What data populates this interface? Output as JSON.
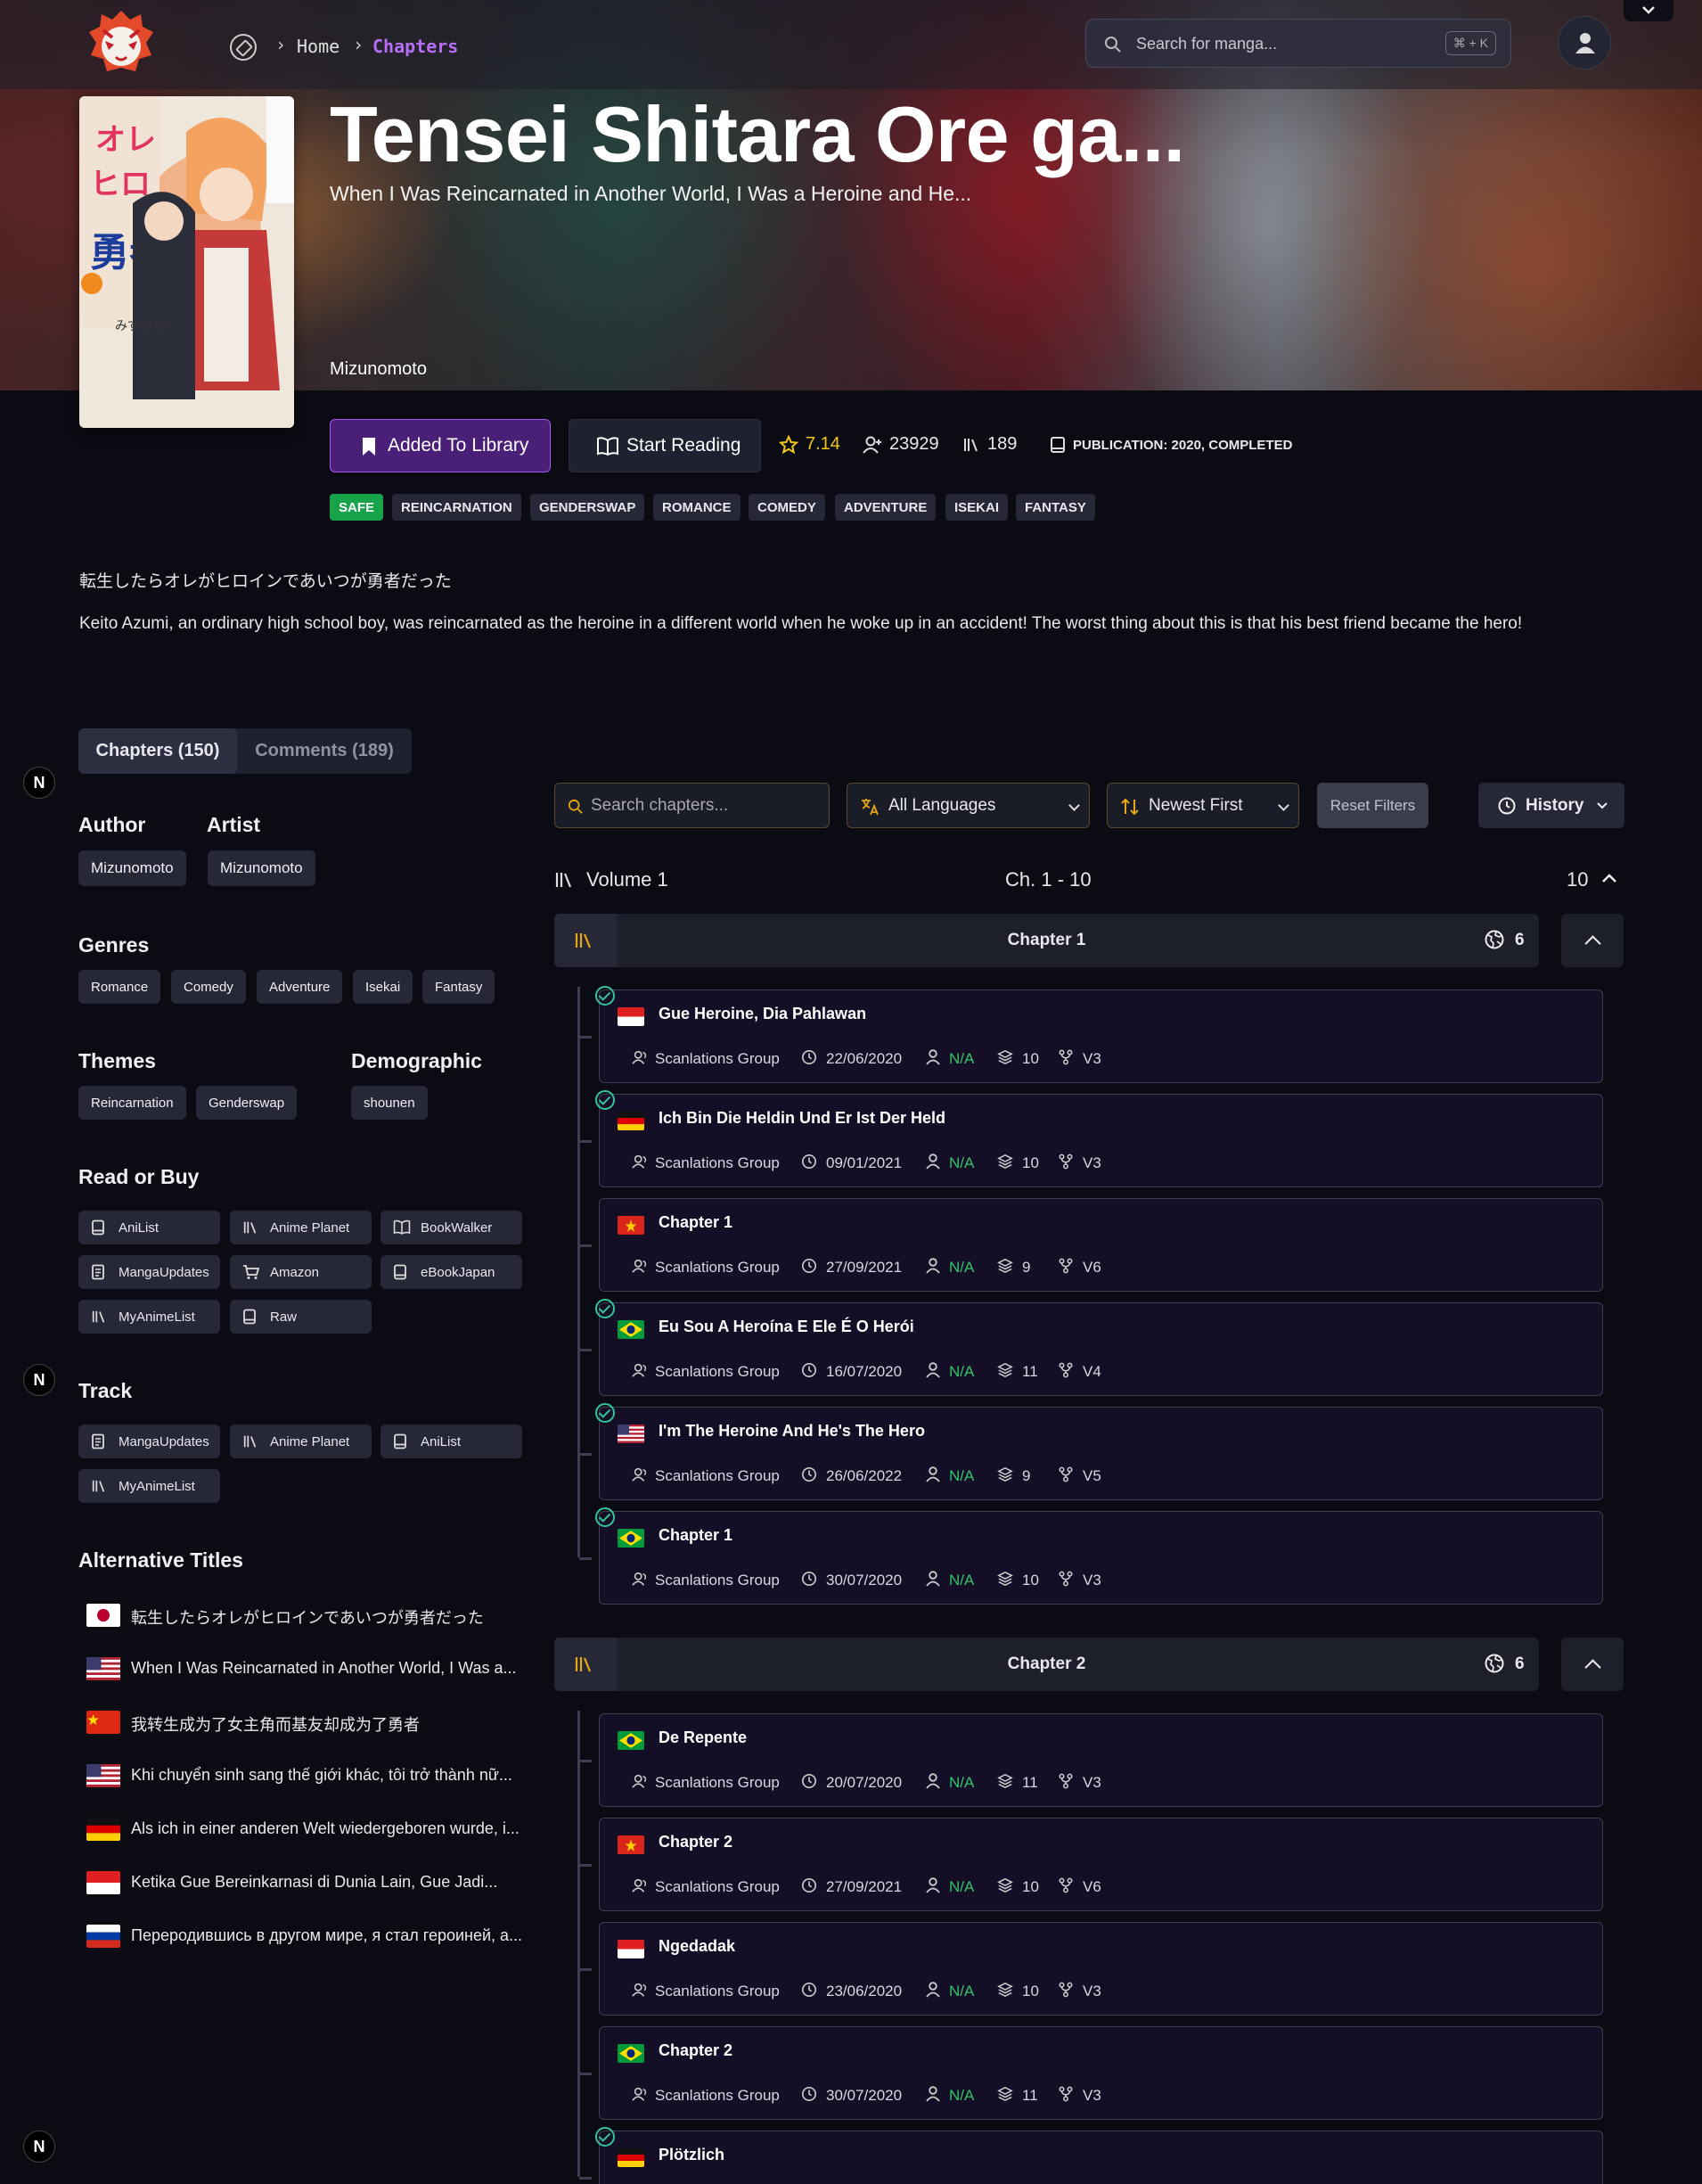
{
  "nav": {
    "home": "Home",
    "current": "Chapters",
    "search_placeholder": "Search for manga...",
    "search_shortcut": "⌘ + K"
  },
  "manga": {
    "title": "Tensei Shitara Ore ga...",
    "subtitle": "When I Was Reincarnated in Another World, I Was a Heroine and He...",
    "author": "Mizunomoto",
    "library_label": "Added To Library",
    "read_label": "Start Reading",
    "rating": "7.14",
    "follows": "23929",
    "comments_count": "189",
    "publication": "PUBLICATION: 2020, COMPLETED",
    "content_rating": "SAFE",
    "tags": [
      "REINCARNATION",
      "GENDERSWAP",
      "ROMANCE",
      "COMEDY",
      "ADVENTURE",
      "ISEKAI",
      "FANTASY"
    ],
    "original_title": "転生したらオレがヒロインであいつが勇者だった",
    "description": "Keito Azumi, an ordinary high school boy, was reincarnated as the heroine in a different world when he woke up in an accident! The worst thing about this is that his best friend became the hero!"
  },
  "tabs": {
    "chapters": "Chapters (150)",
    "comments": "Comments (189)"
  },
  "badge": "N",
  "sidebar": {
    "author_heading": "Author",
    "author": "Mizunomoto",
    "artist_heading": "Artist",
    "artist": "Mizunomoto",
    "genres_heading": "Genres",
    "genres": [
      "Romance",
      "Comedy",
      "Adventure",
      "Isekai",
      "Fantasy"
    ],
    "themes_heading": "Themes",
    "themes": [
      "Reincarnation",
      "Genderswap"
    ],
    "demographic_heading": "Demographic",
    "demographic": "shounen",
    "buy_heading": "Read or Buy",
    "buy_links": [
      "AniList",
      "Anime Planet",
      "BookWalker",
      "MangaUpdates",
      "Amazon",
      "eBookJapan",
      "MyAnimeList",
      "Raw"
    ],
    "track_heading": "Track",
    "track_links": [
      "MangaUpdates",
      "Anime Planet",
      "AniList",
      "MyAnimeList"
    ],
    "alt_heading": "Alternative Titles",
    "alt_titles": [
      {
        "lang": "jp",
        "text": "転生したらオレがヒロインであいつが勇者だった"
      },
      {
        "lang": "us",
        "text": "When I Was Reincarnated in Another World, I Was a..."
      },
      {
        "lang": "cn",
        "text": "我转生成为了女主角而基友却成为了勇者"
      },
      {
        "lang": "us",
        "text": "Khi chuyển sinh sang thế giới khác, tôi trở thành nữ..."
      },
      {
        "lang": "de",
        "text": "Als ich in einer anderen Welt wiedergeboren wurde, i..."
      },
      {
        "lang": "id",
        "text": "Ketika Gue Bereinkarnasi di Dunia Lain, Gue Jadi..."
      },
      {
        "lang": "ru",
        "text": "Переродившись в другом мире, я стал героиней, а..."
      }
    ]
  },
  "filters": {
    "search_placeholder": "Search chapters...",
    "language": "All Languages",
    "sort": "Newest First",
    "reset": "Reset Filters",
    "history": "History"
  },
  "volume": {
    "label": "Volume 1",
    "range": "Ch. 1 - 10",
    "count": "10"
  },
  "chapter_groups": [
    {
      "title": "Chapter 1",
      "count": "6",
      "entries": [
        {
          "flag": "id",
          "title": "Gue Heroine, Dia Pahlawan",
          "group": "Scanlations Group",
          "date": "22/06/2020",
          "user": "N/A",
          "pages": "10",
          "version": "V3",
          "read": true
        },
        {
          "flag": "de",
          "title": "Ich Bin Die Heldin Und Er Ist Der Held",
          "group": "Scanlations Group",
          "date": "09/01/2021",
          "user": "N/A",
          "pages": "10",
          "version": "V3",
          "read": true
        },
        {
          "flag": "vn",
          "title": "Chapter 1",
          "group": "Scanlations Group",
          "date": "27/09/2021",
          "user": "N/A",
          "pages": "9",
          "version": "V6",
          "read": false
        },
        {
          "flag": "br",
          "title": "Eu Sou A Heroína E Ele É O Herói",
          "group": "Scanlations Group",
          "date": "16/07/2020",
          "user": "N/A",
          "pages": "11",
          "version": "V4",
          "read": true
        },
        {
          "flag": "us",
          "title": "I'm The Heroine And He's The Hero",
          "group": "Scanlations Group",
          "date": "26/06/2022",
          "user": "N/A",
          "pages": "9",
          "version": "V5",
          "read": true
        },
        {
          "flag": "br",
          "title": "Chapter 1",
          "group": "Scanlations Group",
          "date": "30/07/2020",
          "user": "N/A",
          "pages": "10",
          "version": "V3",
          "read": true
        }
      ]
    },
    {
      "title": "Chapter 2",
      "count": "6",
      "entries": [
        {
          "flag": "br",
          "title": "De Repente",
          "group": "Scanlations Group",
          "date": "20/07/2020",
          "user": "N/A",
          "pages": "11",
          "version": "V3",
          "read": false
        },
        {
          "flag": "vn",
          "title": "Chapter 2",
          "group": "Scanlations Group",
          "date": "27/09/2021",
          "user": "N/A",
          "pages": "10",
          "version": "V6",
          "read": false
        },
        {
          "flag": "id",
          "title": "Ngedadak",
          "group": "Scanlations Group",
          "date": "23/06/2020",
          "user": "N/A",
          "pages": "10",
          "version": "V3",
          "read": false
        },
        {
          "flag": "br",
          "title": "Chapter 2",
          "group": "Scanlations Group",
          "date": "30/07/2020",
          "user": "N/A",
          "pages": "11",
          "version": "V3",
          "read": false
        },
        {
          "flag": "de",
          "title": "Plötzlich",
          "read": true
        }
      ]
    }
  ],
  "colors": {
    "accent": "#a557f0",
    "breadcrumb_active": "#b56ef5",
    "rating": "#f5c518",
    "safe_tag": "#16a34a",
    "na_text": "#34c36c",
    "read_check": "#34c39a",
    "volume_icon": "#e6a817"
  }
}
